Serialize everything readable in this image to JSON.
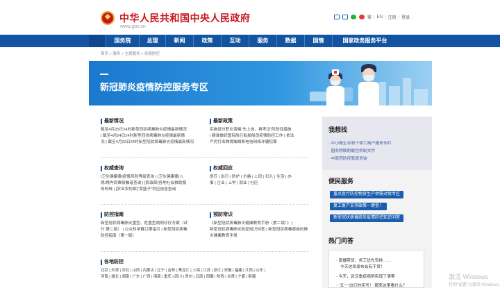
{
  "header": {
    "site_title": "中华人民共和国中央人民政府",
    "site_url": "www.gov.cn",
    "top_links": [
      "繁",
      "|",
      "EN",
      "|",
      "注册",
      "|",
      "登录"
    ]
  },
  "nav": {
    "items": [
      "国务院",
      "总理",
      "新闻",
      "政策",
      "互动",
      "服务",
      "数据",
      "国情",
      "国家政务服务平台"
    ]
  },
  "breadcrumb": [
    "首页",
    ">",
    "服务",
    ">",
    "主题服务",
    ">",
    "疫情防控"
  ],
  "banner": {
    "title": "新冠肺炎疫情防控服务专区"
  },
  "sections": {
    "latest": {
      "title": "最新情况",
      "lines": [
        "截至4月25日24时新型冠状病毒肺炎疫情最新情况",
        "| 截至4月24日24时新型冠状病毒肺炎疫情最新情",
        "况 | 截至4月23日24时新型冠状病毒肺炎疫情最新情况"
      ]
    },
    "policy": {
      "title": "最新政策",
      "lines": [
        "实施部分职业资格“先上岗、再考证”阶段性措施",
        "| 精准做好国际航行船舶船员疫情防控工作 | 依法",
        "严厉打击跨境贿赂和电信网络诈骗犯罪"
      ]
    },
    "query": {
      "title": "权威查询",
      "lines": [
        "[卫生健康委]疫情风险等级查询 | [卫生健康委]入",
        "境/境内同乘接触者查询 | [民政部]各地社会救助服",
        "务热线 | [农业农村部]“菜篮子”供应信息查询"
      ]
    },
    "response": {
      "title": "权威回应",
      "lines": [
        "医疗 | 出行 | 防护 | 价格 | 上班 | 妇儿 | 生活 | 办",
        "事 | 企业 | 上学 | 就业 | 社区"
      ]
    },
    "guide": {
      "title": "防控指南",
      "lines": [
        "新型冠状病毒肺炎重型、危重型病例诊疗方案（试",
        "行 第二版） | 公众科学戴口罩指引 | 新型冠状病毒",
        "防控指南（第一版）"
      ]
    },
    "common": {
      "title": "预防常识",
      "lines": [
        "《新型冠状病毒肺炎健康教育手册（第二版）》 |",
        "新型冠状病毒肺炎防控知识问答 | 新型冠状病毒感染的肺",
        "炎健康教育手册"
      ]
    },
    "regions": {
      "title": "各地防控",
      "lines": [
        "北京 | 天津 | 河北 | 山西 | 内蒙古 | 辽宁 | 吉林 | 黑龙江 | 上海 | 江苏 | 浙江 | 安徽 | 福建 | 江西 | 山东 |",
        "河南 | 湖北 | 湖南 | 广东 | 广西 | 海南 | 重庆 | 四川 | 贵州 | 云南 | 西藏 | 陕西 | 甘肃 | 宁夏 | 新疆"
      ]
    }
  },
  "sidebar": {
    "help_title": "我想找",
    "help_links": [
      "· 中小微企业和个体工商户服务专栏",
      "· 国务院联防联控机制文件",
      "· 中医药防控就医咨询"
    ],
    "service_title": "便民服务",
    "service_buttons": [
      "重点医疗防控物资生产供需对接专区",
      "复工复产支持政策一键查！",
      "新型冠状病毒肺炎疫情防控知识问答"
    ],
    "qa_title": "热门问答",
    "qa_items": [
      "· 直播带货、务工优先安排……",
      "今天这场发布会有干货！",
      "· 今天，武汉重症病例实现了清零",
      "· “五一”出行的实写！ 都来这里看什么？"
    ]
  },
  "watermark": {
    "line1": "激活 Windows",
    "line2": "转到“设置”以激活 Windows。"
  }
}
